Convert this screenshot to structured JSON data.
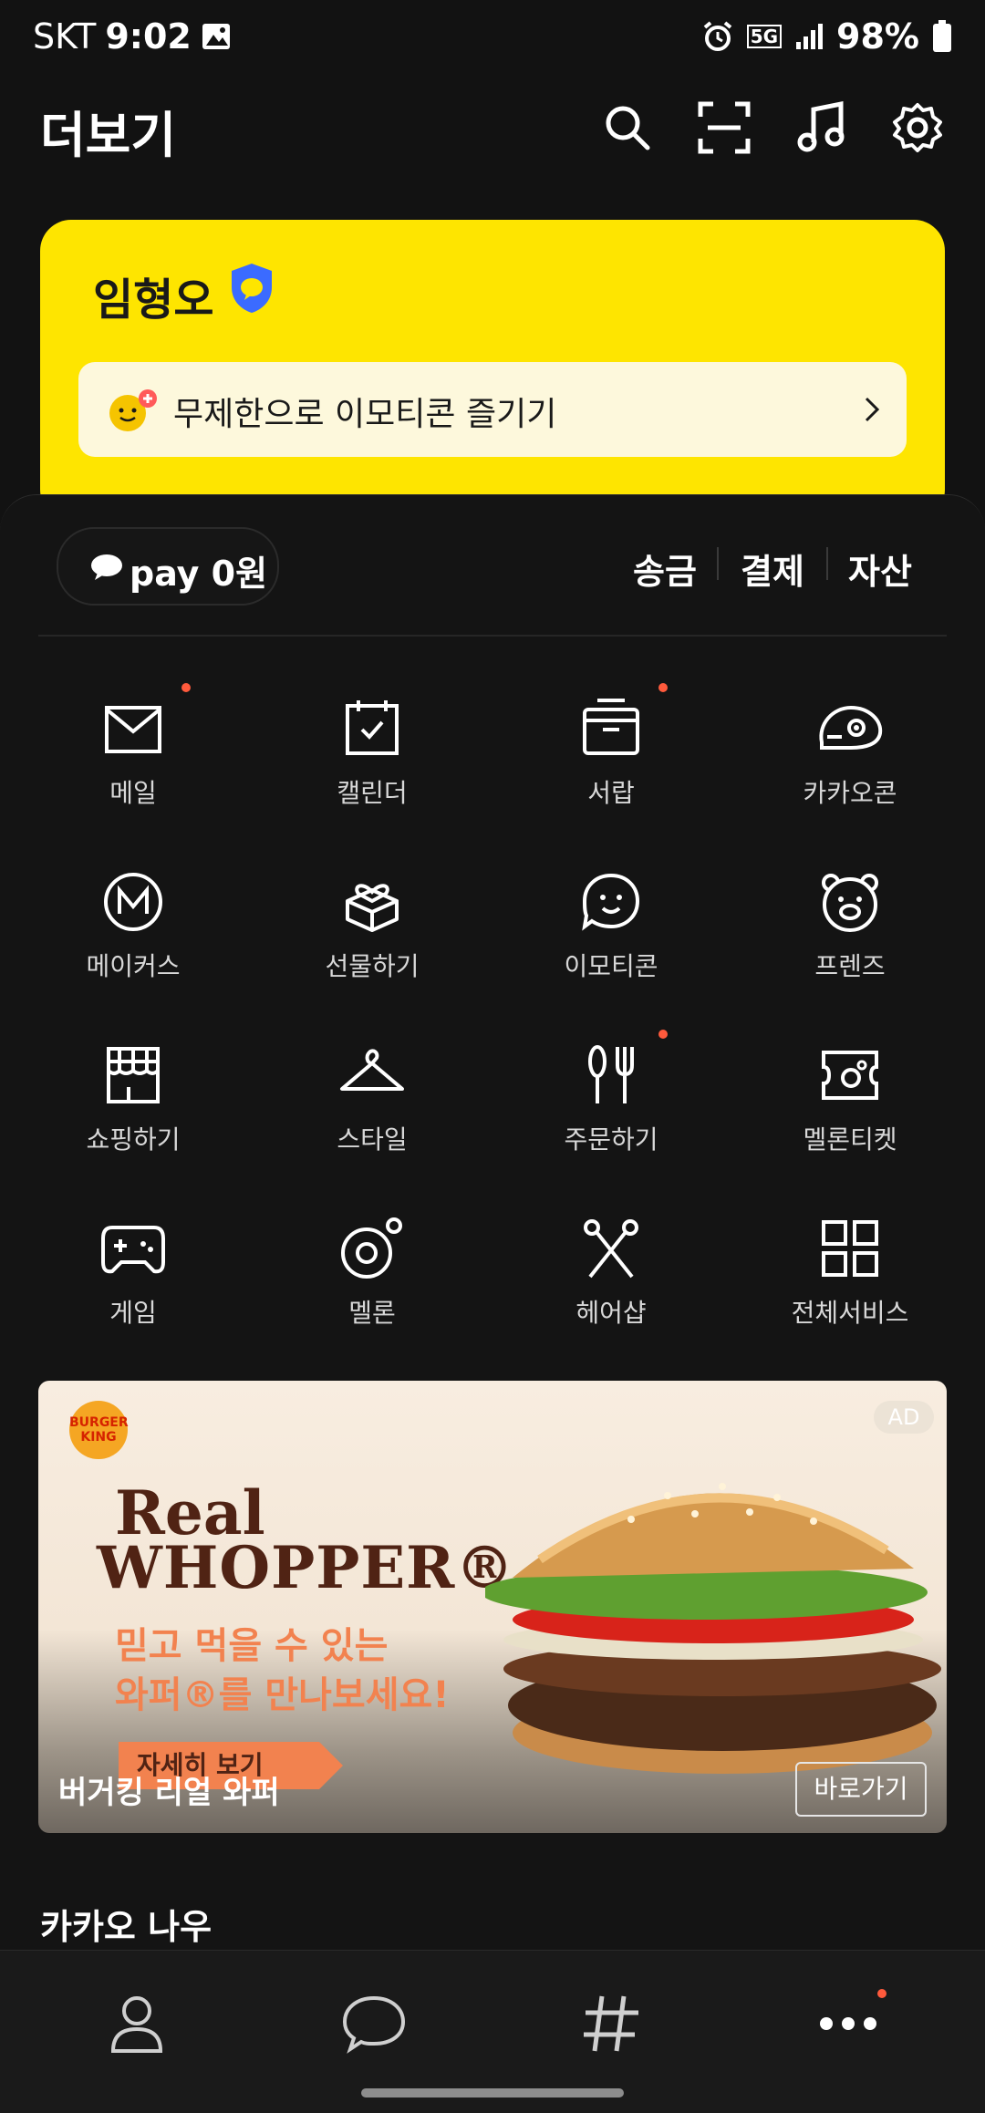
{
  "status_bar": {
    "carrier": "SKT",
    "time": "9:02",
    "battery": "98%",
    "network": "5G"
  },
  "header": {
    "title": "더보기"
  },
  "profile": {
    "name": "임형오",
    "emoticon_banner": "무제한으로 이모티콘 즐기기"
  },
  "pay": {
    "label": "pay 0원",
    "links": [
      "송금",
      "결제",
      "자산"
    ]
  },
  "services": [
    {
      "label": "메일",
      "icon": "mail-icon",
      "badge": true
    },
    {
      "label": "캘린더",
      "icon": "calendar-icon",
      "badge": false
    },
    {
      "label": "서랍",
      "icon": "drawer-icon",
      "badge": true
    },
    {
      "label": "카카오콘",
      "icon": "kakaocon-icon",
      "badge": false
    },
    {
      "label": "메이커스",
      "icon": "makers-icon",
      "badge": false
    },
    {
      "label": "선물하기",
      "icon": "gift-icon",
      "badge": false
    },
    {
      "label": "이모티콘",
      "icon": "emoticon-icon",
      "badge": false
    },
    {
      "label": "프렌즈",
      "icon": "friends-icon",
      "badge": false
    },
    {
      "label": "쇼핑하기",
      "icon": "shopping-icon",
      "badge": false
    },
    {
      "label": "스타일",
      "icon": "hanger-icon",
      "badge": false
    },
    {
      "label": "주문하기",
      "icon": "fork-icon",
      "badge": true
    },
    {
      "label": "멜론티켓",
      "icon": "ticket-icon",
      "badge": false
    },
    {
      "label": "게임",
      "icon": "gamepad-icon",
      "badge": false
    },
    {
      "label": "멜론",
      "icon": "melon-icon",
      "badge": false
    },
    {
      "label": "헤어샵",
      "icon": "scissors-icon",
      "badge": false
    },
    {
      "label": "전체서비스",
      "icon": "grid-icon",
      "badge": false
    }
  ],
  "ad": {
    "badge": "AD",
    "brand": "BURGER KING",
    "headline1": "Real",
    "headline2": "WHOPPER®",
    "tagline1": "믿고 먹을 수 있는",
    "tagline2": "와퍼®를 만나보세요!",
    "cta": "자세히 보기",
    "title": "버거킹 리얼 와퍼",
    "go": "바로가기"
  },
  "section": {
    "title": "카카오 나우"
  },
  "bottom_nav": [
    "friends-icon",
    "chat-icon",
    "hashtag-icon",
    "more-icon"
  ],
  "colors": {
    "kakao_yellow": "#fee500",
    "badge_red": "#ff5a3c",
    "background": "#121212"
  }
}
